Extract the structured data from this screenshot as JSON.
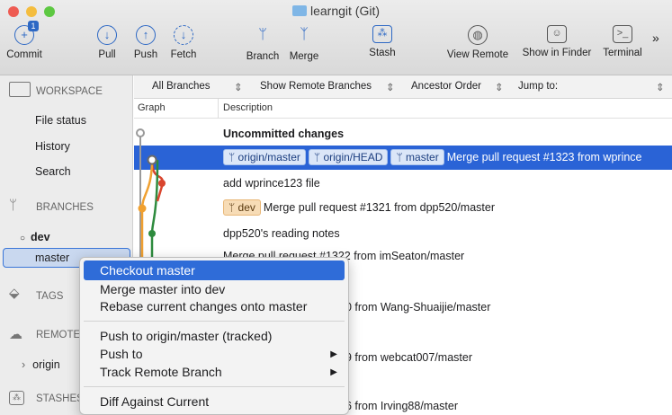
{
  "window": {
    "title": "learngit (Git)"
  },
  "toolbar": {
    "commit": "Commit",
    "commit_badge": "1",
    "pull": "Pull",
    "push": "Push",
    "fetch": "Fetch",
    "branch": "Branch",
    "merge": "Merge",
    "stash": "Stash",
    "view_remote": "View Remote",
    "show_in_finder": "Show in Finder",
    "terminal": "Terminal",
    "more": "»"
  },
  "sidebar": {
    "workspace": "WORKSPACE",
    "file_status": "File status",
    "history": "History",
    "search": "Search",
    "branches": "BRANCHES",
    "dev": "dev",
    "master": "master",
    "tags": "TAGS",
    "remotes": "REMOTES",
    "origin": "origin",
    "stashes": "STASHES"
  },
  "filters": {
    "all_branches": "All Branches",
    "show_remote": "Show Remote Branches",
    "ancestor": "Ancestor Order",
    "jump": "Jump to:"
  },
  "columns": {
    "graph": "Graph",
    "description": "Description"
  },
  "rows": [
    {
      "desc": "Uncommitted changes"
    },
    {
      "tags": [
        "origin/master",
        "origin/HEAD",
        "master"
      ],
      "desc": "Merge pull request #1323 from wprince"
    },
    {
      "desc": "add wprince123 file"
    },
    {
      "tag_dev": "dev",
      "desc": "Merge pull request #1321 from dpp520/master"
    },
    {
      "desc": "dpp520's reading notes"
    },
    {
      "desc": "Merge pull request #1322 from imSeaton/master"
    },
    {
      "desc": "20 from Wang-Shuaijie/master"
    },
    {
      "desc": "19 from webcat007/master"
    },
    {
      "desc": "t"
    },
    {
      "desc": "16 from Irving88/master"
    }
  ],
  "menu": {
    "checkout": "Checkout master",
    "merge": "Merge master into dev",
    "rebase": "Rebase current changes onto master",
    "push_origin": "Push to origin/master (tracked)",
    "push_to": "Push to",
    "track": "Track Remote Branch",
    "diff": "Diff Against Current",
    "submenu_arrow": "▶"
  },
  "colors": {
    "selection": "#2a63d6",
    "accent": "#2d68c4",
    "orange_graph": "#f0a030",
    "green_graph": "#2e8b3e",
    "red_graph": "#d9452e"
  }
}
